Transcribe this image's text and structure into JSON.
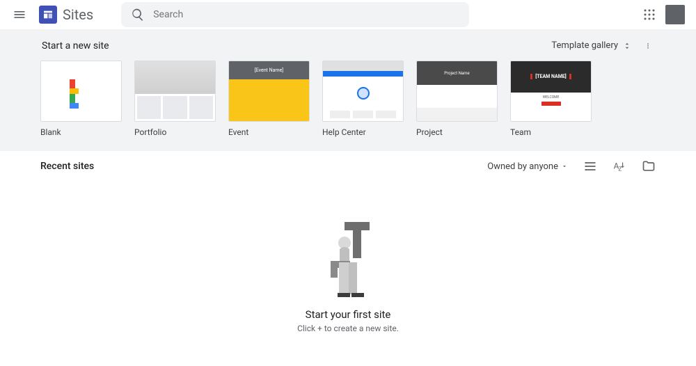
{
  "header": {
    "app_title": "Sites",
    "search_placeholder": "Search"
  },
  "gallery": {
    "title": "Start a new site",
    "template_gallery_label": "Template gallery",
    "templates": [
      {
        "label": "Blank"
      },
      {
        "label": "Portfolio"
      },
      {
        "label": "Event",
        "hero_text": "[Event Name]"
      },
      {
        "label": "Help Center"
      },
      {
        "label": "Project",
        "hero_text": "Project Name"
      },
      {
        "label": "Team",
        "hero_text": "[TEAM NAME]",
        "welcome_text": "WELCOME"
      }
    ]
  },
  "recent": {
    "title": "Recent sites",
    "owned_by": "Owned by anyone"
  },
  "empty": {
    "title": "Start your first site",
    "subtitle": "Click + to create a new site."
  }
}
